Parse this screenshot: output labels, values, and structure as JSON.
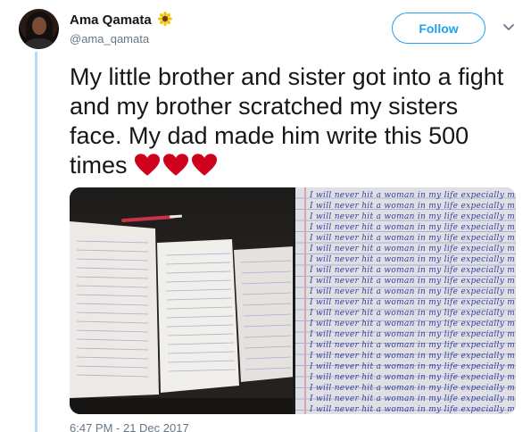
{
  "user": {
    "name": "Ama Qamata",
    "handle": "@ama_qamata"
  },
  "follow_label": "Follow",
  "tweet": {
    "text": "My little brother and sister got into a fight and my brother scratched my sisters face. My dad made him write this 500 times",
    "timestamp": "6:47 PM - 21 Dec 2017"
  },
  "icons": {
    "name_emoji": "sunflower-icon",
    "menu": "chevron-down-icon",
    "emoji": "heart-icon"
  },
  "colors": {
    "accent": "#1da1f2",
    "thread": "#b6dbf4",
    "heart": "#d0021b",
    "ink": "#3a3e98"
  },
  "handwriting": [
    "I will never hit a woman in my life expecially my sister"
  ]
}
